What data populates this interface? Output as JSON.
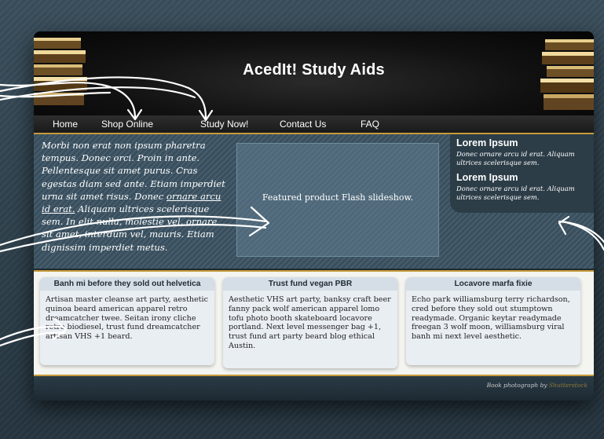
{
  "header": {
    "title": "AcedIt! Study Aids"
  },
  "nav": {
    "items": [
      "Home",
      "Shop Online",
      "Study Now!",
      "Contact Us",
      "FAQ"
    ]
  },
  "hero": {
    "intro_before_link": "Morbi non erat non ipsum pharetra tempus. Donec orci. Proin in ante. Pellentesque sit amet purus. Cras egestas diam sed ante. Etiam imperdiet urna sit amet risus. Donec ",
    "intro_link": "ornare arcu id erat.",
    "intro_after_link": " Aliquam ultrices scelerisque sem. In elit nulla, molestie vel, ornare sit amet, interdum vel, mauris. Etiam dignissim imperdiet metus.",
    "slideshow_label": "Featured product Flash slideshow."
  },
  "sidebar": {
    "blocks": [
      {
        "title": "Lorem Ipsum",
        "body": "Donec ornare arcu id erat. Aliquam ultrices scelerisque sem."
      },
      {
        "title": "Lorem Ipsum",
        "body": "Donec ornare arcu id erat. Aliquam ultrices scelerisque sem."
      }
    ]
  },
  "cards": [
    {
      "title": "Banh mi before they sold out helvetica",
      "body": "Artisan master cleanse art party, aesthetic quinoa beard american apparel retro dreamcatcher twee. Seitan irony cliche retro biodiesel, trust fund dreamcatcher artisan VHS +1 beard."
    },
    {
      "title": "Trust fund vegan PBR",
      "body": "Aesthetic VHS art party, banksy craft beer fanny pack wolf american apparel lomo tofu photo booth skateboard locavore portland. Next level messenger bag +1, trust fund art party beard blog ethical Austin."
    },
    {
      "title": "Locavore marfa fixie",
      "body": "Echo park williamsburg terry richardson, cred before they sold out stumptown readymade. Organic keytar readymade freegan 3 wolf moon, williamsburg viral banh mi next level aesthetic."
    }
  ],
  "footer": {
    "credit_prefix": "Book photograph by ",
    "credit_link": "Shutterstock"
  },
  "colors": {
    "accent": "#c89a3b",
    "hero_bg": "#3c5363",
    "header_bg": "#0b0b0b"
  },
  "icons": {
    "annotation": "hand-drawn-arrow-icon"
  }
}
